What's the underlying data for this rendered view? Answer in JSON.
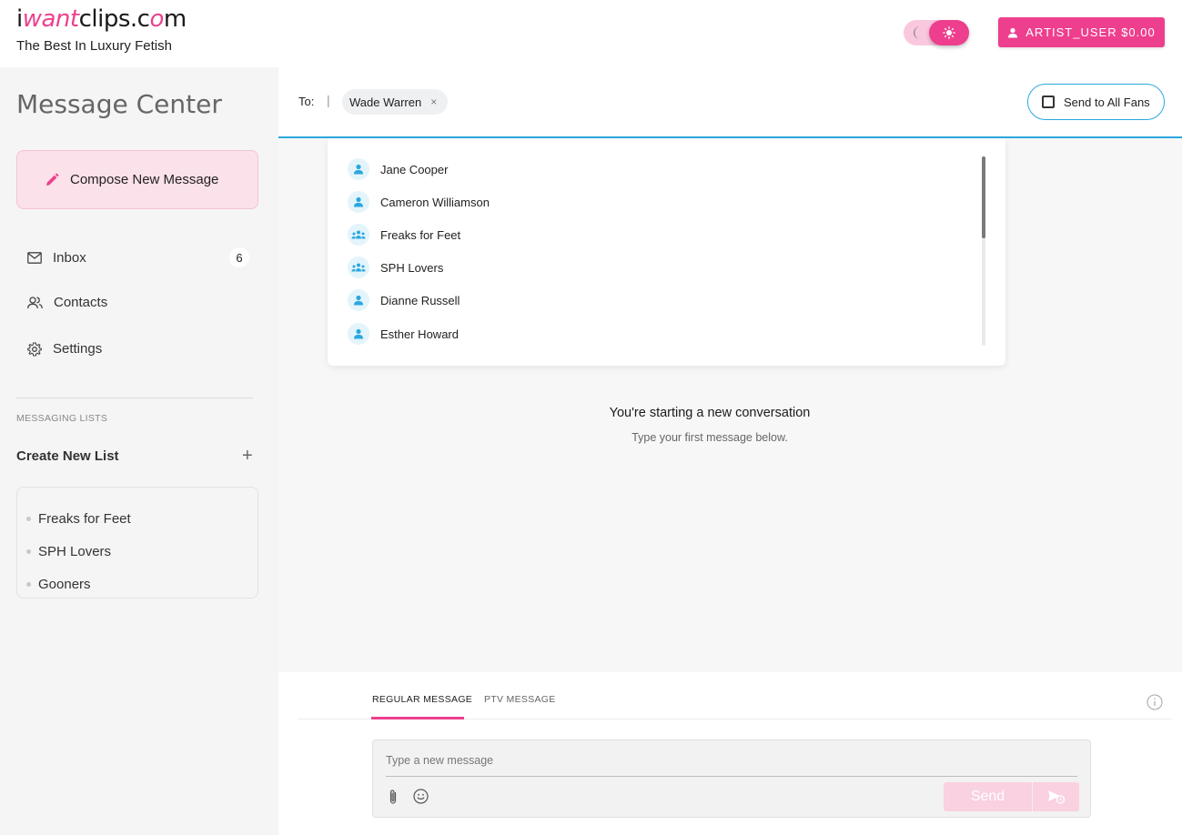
{
  "header": {
    "logo_prefix": "i",
    "logo_highlight": "want",
    "logo_suffix": "clips.c",
    "logo_o": "o",
    "logo_end": "m",
    "tagline": "The Best In Luxury Fetish",
    "user_label": "ARTIST_USER $0.00"
  },
  "sidebar": {
    "title": "Message Center",
    "compose_label": "Compose New Message",
    "nav": [
      {
        "label": "Inbox",
        "icon": "mail-icon",
        "count": "6"
      },
      {
        "label": "Contacts",
        "icon": "contacts-icon"
      },
      {
        "label": "Settings",
        "icon": "gear-icon"
      }
    ],
    "lists_heading": "MESSAGING LISTS",
    "create_list_label": "Create New List",
    "create_list_plus": "+",
    "lists": [
      "Freaks for Feet",
      "SPH Lovers",
      "Gooners"
    ]
  },
  "recipient": {
    "to_label": "To:",
    "separator": "|",
    "chip_name": "Wade Warren",
    "chip_remove": "×",
    "send_all_label": "Send to All Fans"
  },
  "dropdown": {
    "items": [
      {
        "name": "Jane Cooper",
        "type": "person"
      },
      {
        "name": "Cameron Williamson",
        "type": "person"
      },
      {
        "name": "Freaks for Feet",
        "type": "group"
      },
      {
        "name": "SPH Lovers",
        "type": "group"
      },
      {
        "name": "Dianne Russell",
        "type": "person"
      },
      {
        "name": "Esther Howard",
        "type": "person"
      }
    ]
  },
  "conversation": {
    "title": "You're starting a new conversation",
    "subtitle": "Type your first message below."
  },
  "composer": {
    "tabs": [
      "REGULAR MESSAGE",
      "PTV MESSAGE"
    ],
    "active_tab": "REGULAR MESSAGE",
    "placeholder": "Type a new message",
    "send_label": "Send"
  },
  "colors": {
    "accent": "#ee3f8e",
    "blue": "#29a8e0"
  }
}
